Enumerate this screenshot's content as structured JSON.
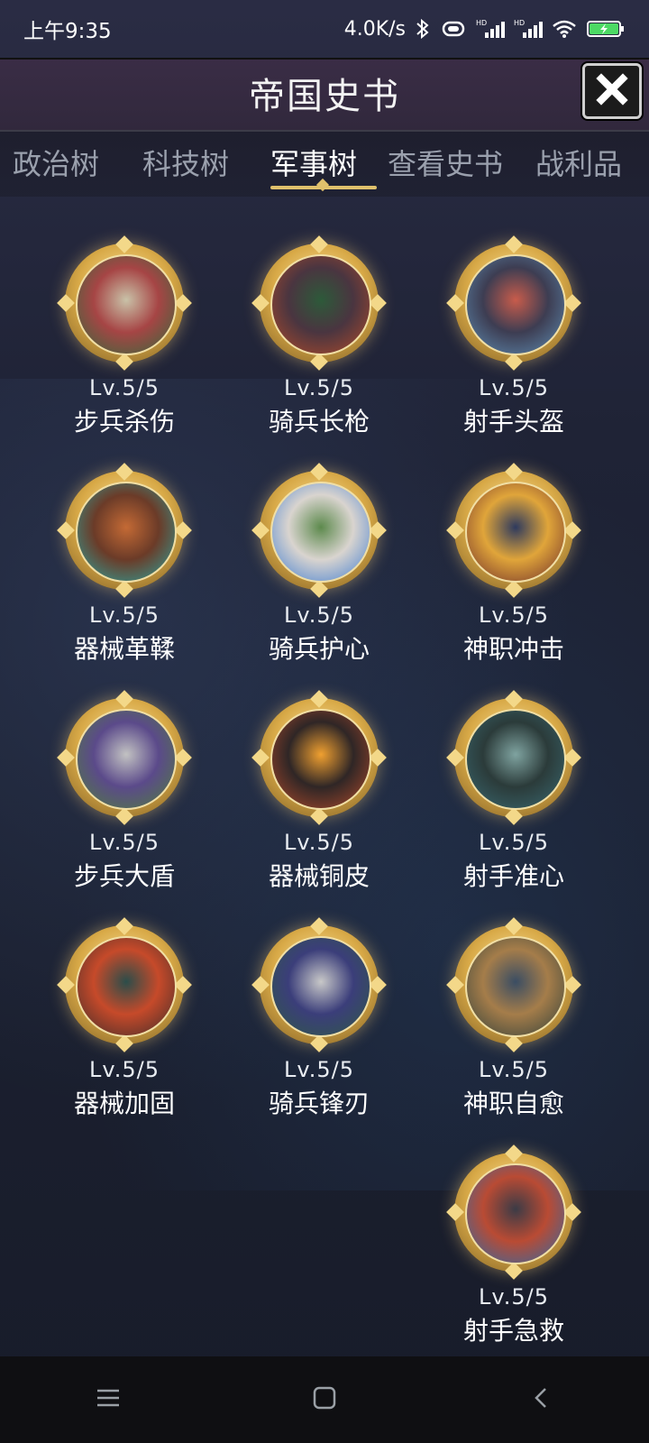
{
  "status_bar": {
    "time": "上午9:35",
    "net_speed": "4.0K/s",
    "icons": [
      "bluetooth-icon",
      "vibrate-icon",
      "signal-hd-1-icon",
      "signal-hd-2-icon",
      "wifi-icon",
      "battery-charging-icon"
    ]
  },
  "header": {
    "title": "帝国史书",
    "close_icon": "close-icon"
  },
  "tabs": [
    {
      "label": "政治树",
      "active": false
    },
    {
      "label": "科技树",
      "active": false
    },
    {
      "label": "军事树",
      "active": true
    },
    {
      "label": "查看史书",
      "active": false
    },
    {
      "label": "战利品",
      "active": false
    }
  ],
  "skills": [
    {
      "level": "Lv.5/5",
      "name": "步兵杀伤",
      "icon": "infantry-knight-icon",
      "colors": [
        "#2f6b3b",
        "#a64545",
        "#c9c2a8"
      ]
    },
    {
      "level": "Lv.5/5",
      "name": "骑兵长枪",
      "icon": "cavalry-lance-icon",
      "colors": [
        "#b34b2a",
        "#4a3540",
        "#2d5a3a"
      ]
    },
    {
      "level": "Lv.5/5",
      "name": "射手头盔",
      "icon": "archer-helmet-icon",
      "colors": [
        "#5f8fb6",
        "#3d3d52",
        "#c85c4b"
      ]
    },
    {
      "level": "Lv.5/5",
      "name": "器械革鞣",
      "icon": "machine-leather-icon",
      "colors": [
        "#2aa9a2",
        "#6b3b28",
        "#c46a35"
      ]
    },
    {
      "level": "Lv.5/5",
      "name": "骑兵护心",
      "icon": "cavalry-guard-icon",
      "colors": [
        "#3c7bd1",
        "#d9d4cf",
        "#5d8a4d"
      ]
    },
    {
      "level": "Lv.5/5",
      "name": "神职冲击",
      "icon": "clergy-strike-icon",
      "colors": [
        "#6b2a2a",
        "#e0a53a",
        "#2e3a5e"
      ]
    },
    {
      "level": "Lv.5/5",
      "name": "步兵大盾",
      "icon": "infantry-shield-icon",
      "colors": [
        "#4f7f3a",
        "#5b4a8a",
        "#c2c2c2"
      ]
    },
    {
      "level": "Lv.5/5",
      "name": "器械铜皮",
      "icon": "machine-bronze-icon",
      "colors": [
        "#b34b2a",
        "#2f2626",
        "#f0a030"
      ]
    },
    {
      "level": "Lv.5/5",
      "name": "射手准心",
      "icon": "archer-aim-icon",
      "colors": [
        "#3a6a72",
        "#2b3b3a",
        "#7fa3a0"
      ]
    },
    {
      "level": "Lv.5/5",
      "name": "器械加固",
      "icon": "machine-reinforce-icon",
      "colors": [
        "#3a2b2a",
        "#c64a2a",
        "#2b4d4a"
      ]
    },
    {
      "level": "Lv.5/5",
      "name": "骑兵锋刃",
      "icon": "cavalry-blade-icon",
      "colors": [
        "#2f5a45",
        "#3b3e7a",
        "#c8c8c8"
      ]
    },
    {
      "level": "Lv.5/5",
      "name": "神职自愈",
      "icon": "clergy-heal-icon",
      "colors": [
        "#2f3f3a",
        "#a57d4a",
        "#3a4d63"
      ]
    },
    {
      "level": "Lv.5/5",
      "name": "射手急救",
      "icon": "archer-firstaid-icon",
      "colors": [
        "#2a6aa8",
        "#b94b34",
        "#3b3b46"
      ]
    }
  ],
  "nav_bar": {
    "icons": [
      "menu-icon",
      "home-icon",
      "back-icon"
    ]
  }
}
